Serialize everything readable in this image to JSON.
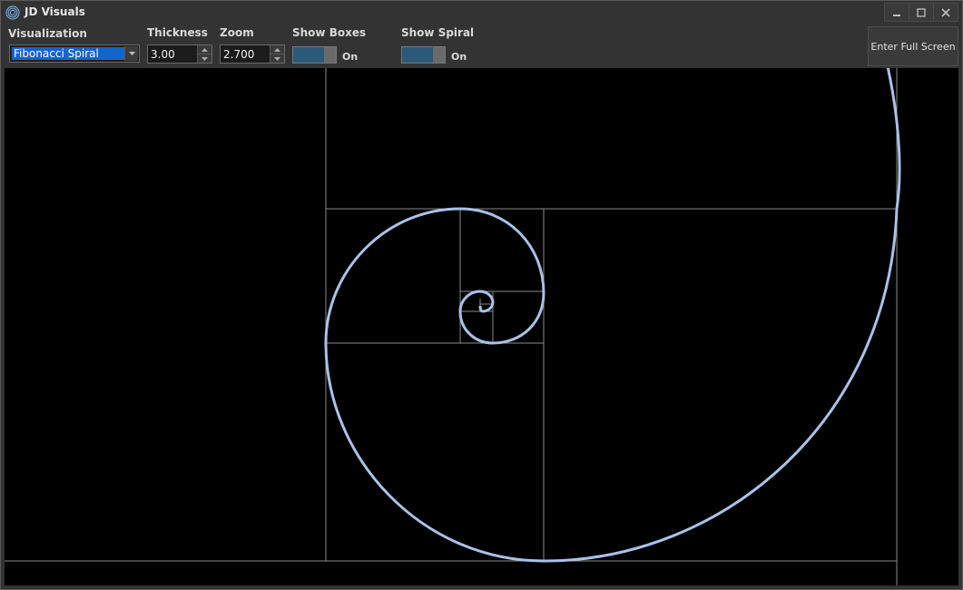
{
  "window": {
    "title": "JD Visuals",
    "icon": "spiral-icon",
    "controls": [
      "minimize-icon",
      "maximize-icon",
      "close-icon"
    ]
  },
  "toolbar": {
    "visualization": {
      "label": "Visualization",
      "value": "Fibonacci Spiral"
    },
    "thickness": {
      "label": "Thickness",
      "value": "3.00"
    },
    "zoom": {
      "label": "Zoom",
      "value": "2.700"
    },
    "show_boxes": {
      "label": "Show Boxes",
      "state": "On",
      "on": true
    },
    "show_spiral": {
      "label": "Show Spiral",
      "state": "On",
      "on": true
    },
    "fullscreen_button": "Enter Full Screen"
  },
  "visual": {
    "type": "fibonacci-spiral",
    "boxes_visible": true,
    "spiral_visible": true,
    "spiral_color": "#a9c2e8",
    "box_color": "#8a8a8a",
    "background": "#000000"
  }
}
